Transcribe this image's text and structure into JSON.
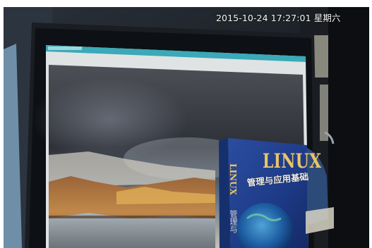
{
  "overlay": {
    "timestamp": "2015-10-24 17:27:01 星期六"
  },
  "book": {
    "cover_title": "LINUX",
    "cover_subtitle": "管理与应用基础",
    "spine_title": "LINUX",
    "spine_subtitle": "管理与"
  },
  "colors": {
    "book_cover": "#1d3a86",
    "book_title": "#e9c46a",
    "monitor_title_bar": "#3aa9b8"
  }
}
